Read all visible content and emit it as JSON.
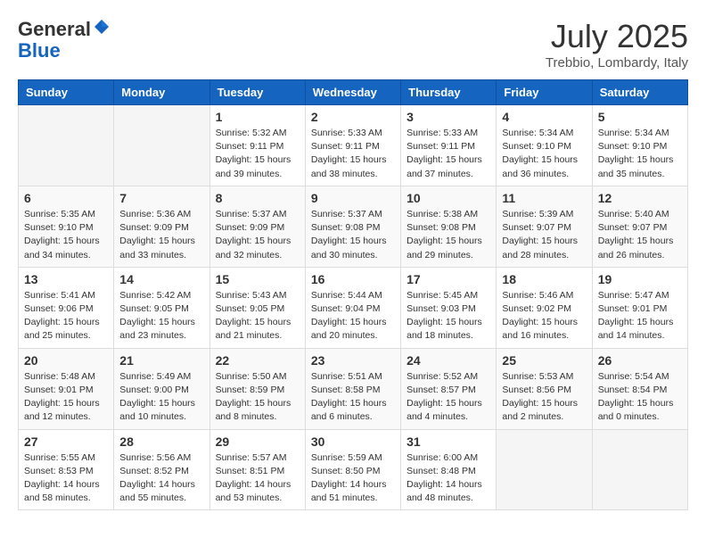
{
  "logo": {
    "general": "General",
    "blue": "Blue"
  },
  "title": "July 2025",
  "location": "Trebbio, Lombardy, Italy",
  "header_days": [
    "Sunday",
    "Monday",
    "Tuesday",
    "Wednesday",
    "Thursday",
    "Friday",
    "Saturday"
  ],
  "weeks": [
    [
      {
        "day": "",
        "info": ""
      },
      {
        "day": "",
        "info": ""
      },
      {
        "day": "1",
        "info": "Sunrise: 5:32 AM\nSunset: 9:11 PM\nDaylight: 15 hours\nand 39 minutes."
      },
      {
        "day": "2",
        "info": "Sunrise: 5:33 AM\nSunset: 9:11 PM\nDaylight: 15 hours\nand 38 minutes."
      },
      {
        "day": "3",
        "info": "Sunrise: 5:33 AM\nSunset: 9:11 PM\nDaylight: 15 hours\nand 37 minutes."
      },
      {
        "day": "4",
        "info": "Sunrise: 5:34 AM\nSunset: 9:10 PM\nDaylight: 15 hours\nand 36 minutes."
      },
      {
        "day": "5",
        "info": "Sunrise: 5:34 AM\nSunset: 9:10 PM\nDaylight: 15 hours\nand 35 minutes."
      }
    ],
    [
      {
        "day": "6",
        "info": "Sunrise: 5:35 AM\nSunset: 9:10 PM\nDaylight: 15 hours\nand 34 minutes."
      },
      {
        "day": "7",
        "info": "Sunrise: 5:36 AM\nSunset: 9:09 PM\nDaylight: 15 hours\nand 33 minutes."
      },
      {
        "day": "8",
        "info": "Sunrise: 5:37 AM\nSunset: 9:09 PM\nDaylight: 15 hours\nand 32 minutes."
      },
      {
        "day": "9",
        "info": "Sunrise: 5:37 AM\nSunset: 9:08 PM\nDaylight: 15 hours\nand 30 minutes."
      },
      {
        "day": "10",
        "info": "Sunrise: 5:38 AM\nSunset: 9:08 PM\nDaylight: 15 hours\nand 29 minutes."
      },
      {
        "day": "11",
        "info": "Sunrise: 5:39 AM\nSunset: 9:07 PM\nDaylight: 15 hours\nand 28 minutes."
      },
      {
        "day": "12",
        "info": "Sunrise: 5:40 AM\nSunset: 9:07 PM\nDaylight: 15 hours\nand 26 minutes."
      }
    ],
    [
      {
        "day": "13",
        "info": "Sunrise: 5:41 AM\nSunset: 9:06 PM\nDaylight: 15 hours\nand 25 minutes."
      },
      {
        "day": "14",
        "info": "Sunrise: 5:42 AM\nSunset: 9:05 PM\nDaylight: 15 hours\nand 23 minutes."
      },
      {
        "day": "15",
        "info": "Sunrise: 5:43 AM\nSunset: 9:05 PM\nDaylight: 15 hours\nand 21 minutes."
      },
      {
        "day": "16",
        "info": "Sunrise: 5:44 AM\nSunset: 9:04 PM\nDaylight: 15 hours\nand 20 minutes."
      },
      {
        "day": "17",
        "info": "Sunrise: 5:45 AM\nSunset: 9:03 PM\nDaylight: 15 hours\nand 18 minutes."
      },
      {
        "day": "18",
        "info": "Sunrise: 5:46 AM\nSunset: 9:02 PM\nDaylight: 15 hours\nand 16 minutes."
      },
      {
        "day": "19",
        "info": "Sunrise: 5:47 AM\nSunset: 9:01 PM\nDaylight: 15 hours\nand 14 minutes."
      }
    ],
    [
      {
        "day": "20",
        "info": "Sunrise: 5:48 AM\nSunset: 9:01 PM\nDaylight: 15 hours\nand 12 minutes."
      },
      {
        "day": "21",
        "info": "Sunrise: 5:49 AM\nSunset: 9:00 PM\nDaylight: 15 hours\nand 10 minutes."
      },
      {
        "day": "22",
        "info": "Sunrise: 5:50 AM\nSunset: 8:59 PM\nDaylight: 15 hours\nand 8 minutes."
      },
      {
        "day": "23",
        "info": "Sunrise: 5:51 AM\nSunset: 8:58 PM\nDaylight: 15 hours\nand 6 minutes."
      },
      {
        "day": "24",
        "info": "Sunrise: 5:52 AM\nSunset: 8:57 PM\nDaylight: 15 hours\nand 4 minutes."
      },
      {
        "day": "25",
        "info": "Sunrise: 5:53 AM\nSunset: 8:56 PM\nDaylight: 15 hours\nand 2 minutes."
      },
      {
        "day": "26",
        "info": "Sunrise: 5:54 AM\nSunset: 8:54 PM\nDaylight: 15 hours\nand 0 minutes."
      }
    ],
    [
      {
        "day": "27",
        "info": "Sunrise: 5:55 AM\nSunset: 8:53 PM\nDaylight: 14 hours\nand 58 minutes."
      },
      {
        "day": "28",
        "info": "Sunrise: 5:56 AM\nSunset: 8:52 PM\nDaylight: 14 hours\nand 55 minutes."
      },
      {
        "day": "29",
        "info": "Sunrise: 5:57 AM\nSunset: 8:51 PM\nDaylight: 14 hours\nand 53 minutes."
      },
      {
        "day": "30",
        "info": "Sunrise: 5:59 AM\nSunset: 8:50 PM\nDaylight: 14 hours\nand 51 minutes."
      },
      {
        "day": "31",
        "info": "Sunrise: 6:00 AM\nSunset: 8:48 PM\nDaylight: 14 hours\nand 48 minutes."
      },
      {
        "day": "",
        "info": ""
      },
      {
        "day": "",
        "info": ""
      }
    ]
  ]
}
